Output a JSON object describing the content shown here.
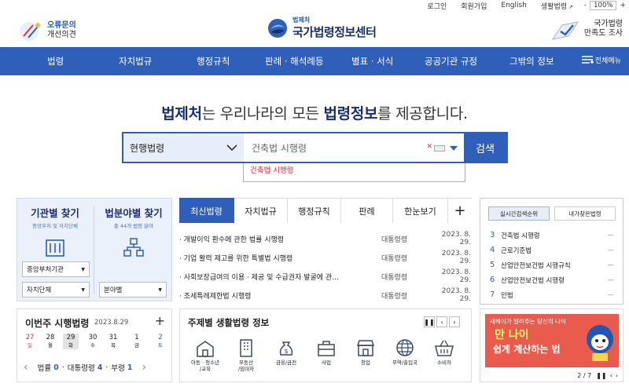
{
  "util": {
    "login": "로그인",
    "join": "회원가입",
    "english": "English",
    "lifelaw": "생활법령",
    "zoom_minus": "-",
    "zoom_value": "100%",
    "zoom_plus": "+"
  },
  "header": {
    "feedback_line1": "오류문의",
    "feedback_line2": "개선의견",
    "logo_small": "법제처",
    "logo_big": "국가법령정보센터",
    "survey_line1": "국가법령",
    "survey_line2": "만족도 조사"
  },
  "nav": {
    "items": [
      "법령",
      "자치법규",
      "행정규칙",
      "판례 · 해석례등",
      "별표 · 서식",
      "공공기관 규정",
      "그밖의 정보"
    ],
    "all_menu": "전체메뉴"
  },
  "hero": {
    "brand": "법제처",
    "text1": "는 우리나라의 모든 ",
    "strong": "법령정보",
    "text2": "를 제공합니다."
  },
  "search": {
    "select_value": "현행법령",
    "query": "건축법 시행령",
    "clear": "✕",
    "button": "검색",
    "suggestion": "건축법 시행령"
  },
  "finder": {
    "agency_title": "기관별 찾기",
    "agency_sub": "중앙부처 및 자치단체",
    "field_title": "법분야별 찾기",
    "field_sub": "총 44개 법령 분야",
    "dd_central": "중앙부처기관",
    "dd_local": "자치단체",
    "dd_field": "분야별"
  },
  "tabs": [
    "최신법령",
    "자치법규",
    "행정규칙",
    "판례",
    "한눈보기",
    "+"
  ],
  "news": [
    {
      "title": "· 개발이익 환수에 관한 법률 시행령",
      "kind": "대통령령",
      "date": "2023. 8. 29."
    },
    {
      "title": "· 기업 활력 제고를 위한 특별법 시행령",
      "kind": "대통령령",
      "date": "2023. 8. 29."
    },
    {
      "title": "· 사회보장급여의 이용 · 제공 및 수급권자 발굴에 관...",
      "kind": "대통령령",
      "date": "2023. 8. 29."
    },
    {
      "title": "· 조세특례제한법 시행령",
      "kind": "대통령령",
      "date": "2023. 8. 29."
    }
  ],
  "rank": {
    "tab_realtime": "실시간검색순위",
    "tab_frequent": "내가찾은법령",
    "items": [
      {
        "num": "3",
        "name": "건축법 시행령",
        "change": "—"
      },
      {
        "num": "4",
        "name": "근로기준법",
        "change": "—"
      },
      {
        "num": "5",
        "name": "산업안전보건법 시행규칙",
        "change": "—"
      },
      {
        "num": "6",
        "name": "산업안전보건법 시행령",
        "change": "—"
      },
      {
        "num": "7",
        "name": "민법",
        "change": "—"
      }
    ]
  },
  "weekly": {
    "title": "이번주 시행법령",
    "date": "2023.8.29",
    "plus": "+",
    "days": [
      {
        "d": "27",
        "w": "일",
        "color": "#e0303a"
      },
      {
        "d": "28",
        "w": "월",
        "color": "#333333"
      },
      {
        "d": "29",
        "w": "화",
        "color": "#333333"
      },
      {
        "d": "30",
        "w": "수",
        "color": "#333333"
      },
      {
        "d": "31",
        "w": "목",
        "color": "#333333"
      },
      {
        "d": "1",
        "w": "금",
        "color": "#333333"
      },
      {
        "d": "2",
        "w": "토",
        "color": "#2f5fb8"
      }
    ],
    "s1_label": "법률",
    "s1_value": "0",
    "s2_label": "대통령령",
    "s2_value": "4",
    "s3_label": "부령",
    "s3_value": "1",
    "prev": "‹",
    "next": "›"
  },
  "theme": {
    "title": "주제별 생활법령 정보",
    "ctrl": [
      "❚❚",
      "‹",
      "›"
    ],
    "icons": [
      {
        "label1": "아동 · 청소년",
        "label2": "/교육"
      },
      {
        "label1": "부동산",
        "label2": "/임대차"
      },
      {
        "label1": "금융/금전",
        "label2": ""
      },
      {
        "label1": "사업",
        "label2": ""
      },
      {
        "label1": "창업",
        "label2": ""
      },
      {
        "label1": "무역/출입국",
        "label2": ""
      },
      {
        "label1": "소비자",
        "label2": ""
      }
    ]
  },
  "banner": {
    "line1": "새해이가 알려주는 당신의 나이",
    "line2": "만 나이",
    "line3": "쉽게 계산하는 법",
    "page": "2 / 7"
  },
  "colors": {
    "primary": "#2f5fb8",
    "navy": "#1a2f6b",
    "red": "#e0303a"
  }
}
